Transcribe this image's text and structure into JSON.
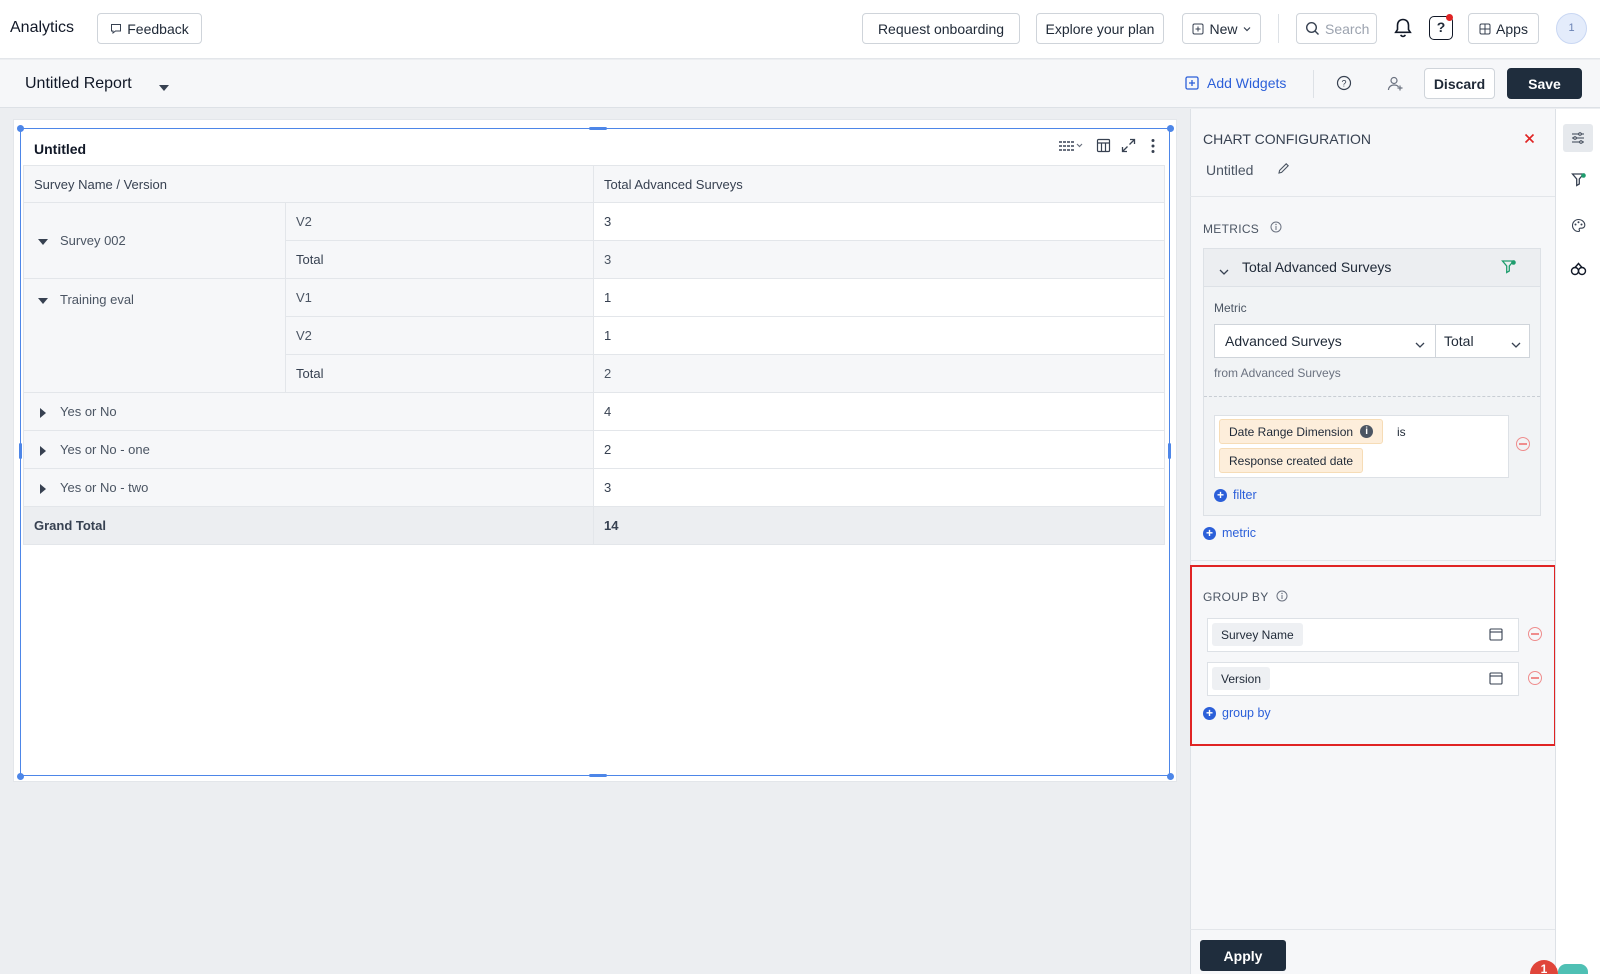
{
  "topbar": {
    "app_title": "Analytics",
    "feedback_label": "Feedback",
    "request_onboarding_label": "Request onboarding",
    "explore_plan_label": "Explore your plan",
    "new_label": "New",
    "search_placeholder": "Search",
    "help_label": "?",
    "apps_label": "Apps",
    "avatar_initial": "1"
  },
  "reportbar": {
    "report_title": "Untitled Report",
    "add_widgets_label": "Add Widgets",
    "discard_label": "Discard",
    "save_label": "Save"
  },
  "widget": {
    "title": "Untitled",
    "col_dimension": "Survey Name / Version",
    "col_metric": "Total Advanced Surveys",
    "groups": [
      {
        "name": "Survey 002",
        "rows": [
          {
            "version": "V2",
            "value": "3"
          },
          {
            "version": "Total",
            "value": "3"
          }
        ]
      },
      {
        "name": "Training eval",
        "rows": [
          {
            "version": "V1",
            "value": "1"
          },
          {
            "version": "V2",
            "value": "1"
          },
          {
            "version": "Total",
            "value": "2"
          }
        ]
      }
    ],
    "collapsed": [
      {
        "name": "Yes or No",
        "value": "4"
      },
      {
        "name": "Yes or No - one",
        "value": "2"
      },
      {
        "name": "Yes or No - two",
        "value": "3"
      }
    ],
    "grand_total_label": "Grand Total",
    "grand_total_value": "14"
  },
  "config": {
    "heading": "CHART CONFIGURATION",
    "chart_name": "Untitled",
    "metrics_title": "METRICS",
    "metric_card_title": "Total Advanced Surveys",
    "metric_label": "Metric",
    "metric_select": "Advanced Surveys",
    "aggregation_select": "Total",
    "metric_source": "from Advanced Surveys",
    "filter_dimension": "Date Range Dimension",
    "filter_operator": "is",
    "filter_value": "Response created date",
    "add_filter_label": "filter",
    "add_metric_label": "metric",
    "group_by_title": "GROUP BY",
    "group_by_items": [
      "Survey Name",
      "Version"
    ],
    "add_group_by_label": "group by",
    "apply_label": "Apply",
    "notification_count": "1"
  },
  "colors": {
    "primary_dark": "#1f2d3d",
    "accent_blue": "#2b5fd9",
    "selection_blue": "#4d86e8",
    "highlight_red": "#e02424",
    "chip_orange": "#fdeedb",
    "remove_red": "#ef8d8d"
  }
}
